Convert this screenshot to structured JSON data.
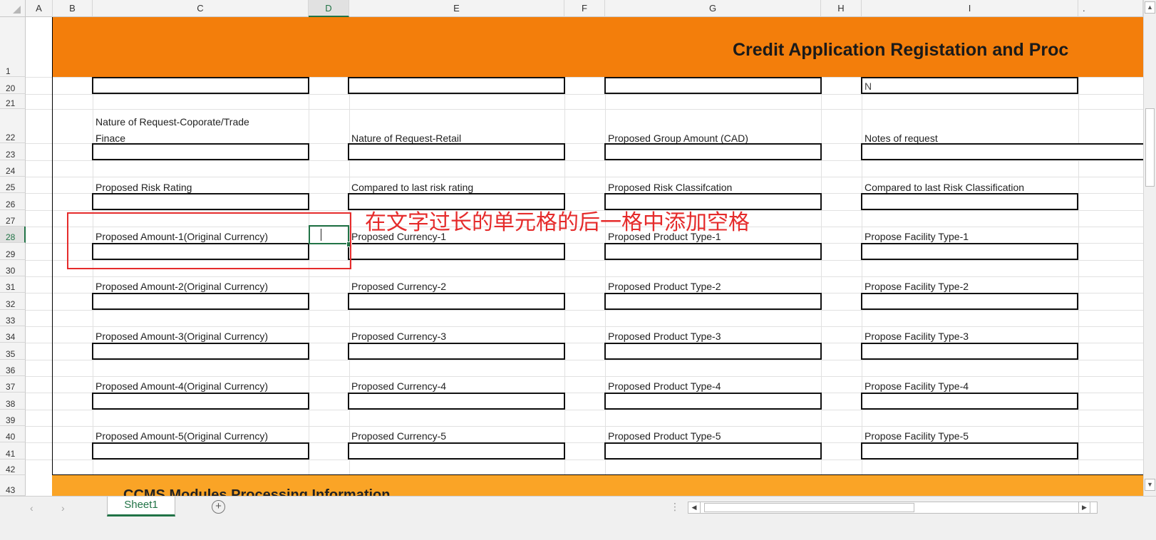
{
  "columns": [
    "A",
    "B",
    "C",
    "D",
    "E",
    "F",
    "G",
    "H",
    "I"
  ],
  "selected_column": "D",
  "rows": [
    "1",
    "20",
    "21",
    "22",
    "23",
    "24",
    "25",
    "26",
    "27",
    "28",
    "29",
    "30",
    "31",
    "32",
    "33",
    "34",
    "35",
    "36",
    "37",
    "38",
    "39",
    "40",
    "41",
    "42",
    "43"
  ],
  "selected_row": "28",
  "title": "Credit Application Registation and Proc",
  "field_labels": [
    {
      "row": "22",
      "c": "Nature of Request-Coporate/Trade",
      "c2": "Finace",
      "e": "Nature of Request-Retail",
      "g": "Proposed Group Amount (CAD)",
      "i": "Notes of request"
    },
    {
      "row": "25",
      "c": "Proposed Risk Rating",
      "e": "Compared to last risk rating",
      "g": "Proposed Risk Classifcation",
      "i": "Compared to last Risk Classification"
    },
    {
      "row": "28",
      "c": "Proposed Amount-1(Original Currency)",
      "e": "Proposed Currency-1",
      "g": "Proposed Product Type-1",
      "i": "Propose Facility Type-1"
    },
    {
      "row": "31",
      "c": "Proposed Amount-2(Original Currency)",
      "e": "Proposed Currency-2",
      "g": "Proposed Product Type-2",
      "i": "Propose Facility Type-2"
    },
    {
      "row": "34",
      "c": "Proposed Amount-3(Original Currency)",
      "e": "Proposed Currency-3",
      "g": "Proposed Product Type-3",
      "i": "Propose Facility Type-3"
    },
    {
      "row": "37",
      "c": "Proposed Amount-4(Original Currency)",
      "e": "Proposed Currency-4",
      "g": "Proposed Product Type-4",
      "i": "Propose Facility Type-4"
    },
    {
      "row": "40",
      "c": "Proposed Amount-5(Original Currency)",
      "e": "Proposed Currency-5",
      "g": "Proposed Product Type-5",
      "i": "Propose Facility Type-5"
    }
  ],
  "row20_value_i": "N",
  "annotation_note": "在文字过长的单元格的后一格中添加空格",
  "section2_title": "CCMS Modules Processing Information",
  "sheet_tab": "Sheet1",
  "add_sheet_symbol": "+",
  "colors": {
    "banner": "#f37e0b",
    "section2": "#faa426",
    "annotation": "#e52b2b",
    "excel_green": "#217346"
  },
  "icons": [
    "scroll-up-icon",
    "scroll-down-icon",
    "scroll-left-icon",
    "scroll-right-icon",
    "add-sheet-icon",
    "nav-prev-icon",
    "nav-next-icon",
    "select-all-icon"
  ]
}
